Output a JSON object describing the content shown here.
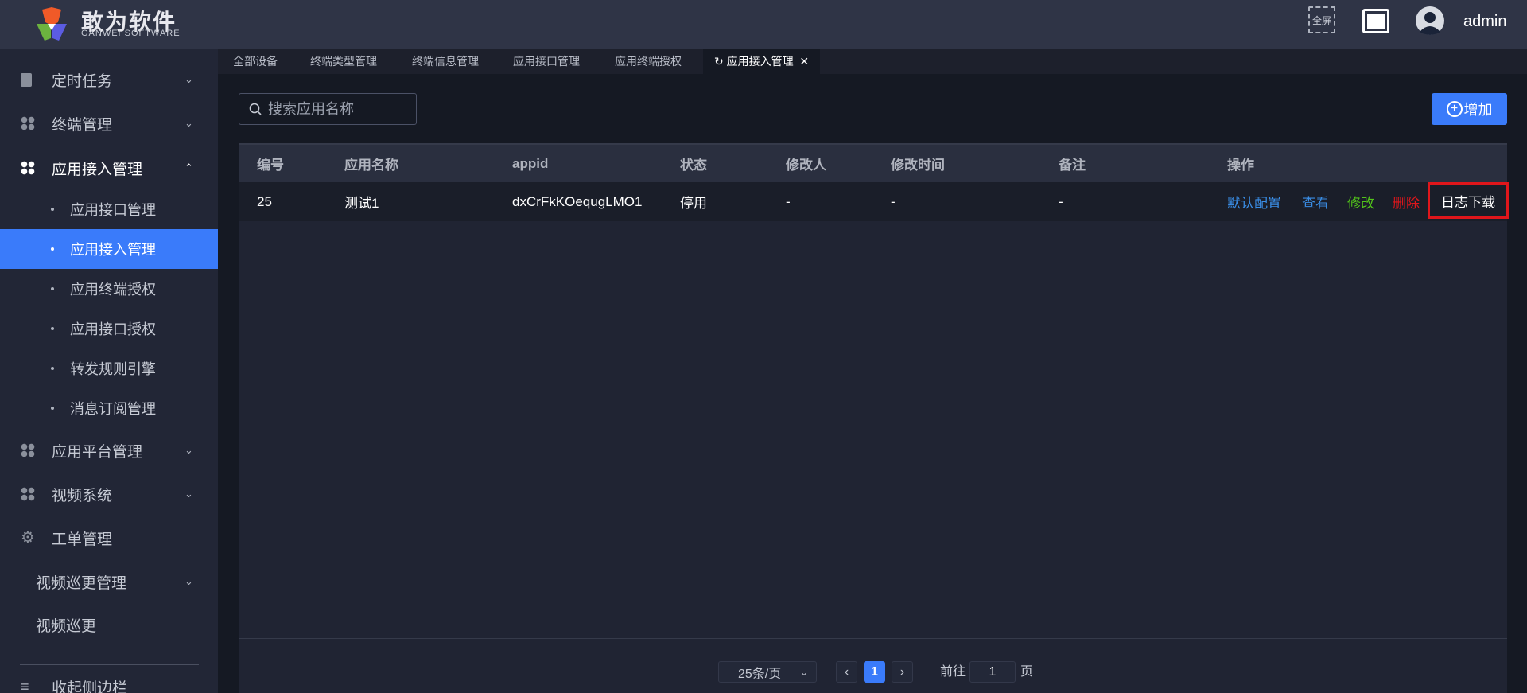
{
  "header": {
    "brand": "敢为软件",
    "brand_sub": "GANWEI SOFTWARE",
    "fullscreen_label": "全屏",
    "username": "admin"
  },
  "sidebar": {
    "items": [
      {
        "label": "定时任务"
      },
      {
        "label": "终端管理"
      },
      {
        "label": "应用接入管理"
      },
      {
        "label": "应用接口管理"
      },
      {
        "label": "应用接入管理"
      },
      {
        "label": "应用终端授权"
      },
      {
        "label": "应用接口授权"
      },
      {
        "label": "转发规则引擎"
      },
      {
        "label": "消息订阅管理"
      },
      {
        "label": "应用平台管理"
      },
      {
        "label": "视频系统"
      },
      {
        "label": "工单管理"
      },
      {
        "label": "视频巡更管理"
      },
      {
        "label": "视频巡更"
      }
    ],
    "collapse_label": "收起侧边栏"
  },
  "tabs": [
    "全部设备",
    "终端类型管理",
    "终端信息管理",
    "应用接口管理",
    "应用终端授权",
    "应用接入管理"
  ],
  "toolbar": {
    "search_placeholder": "搜索应用名称",
    "add_label": "增加"
  },
  "table": {
    "columns": [
      "编号",
      "应用名称",
      "appid",
      "状态",
      "修改人",
      "修改时间",
      "备注",
      "操作"
    ],
    "rows": [
      {
        "id": "25",
        "name": "测试1",
        "appid": "dxCrFkKOequgLMO1",
        "status": "停用",
        "modifier": "-",
        "modified_time": "-",
        "remark": "-"
      }
    ],
    "actions": {
      "default_config": "默认配置",
      "view": "查看",
      "edit": "修改",
      "delete": "删除",
      "log_download": "日志下载"
    }
  },
  "pagination": {
    "page_size": "25条/页",
    "current_page": "1",
    "goto_label": "前往",
    "goto_value": "1",
    "page_suffix": "页"
  },
  "colors": {
    "accent": "#3a7bfa",
    "view": "#3a8ee6",
    "edit": "#52c41a",
    "delete": "#e0161b",
    "highlight": "#e0161b"
  }
}
